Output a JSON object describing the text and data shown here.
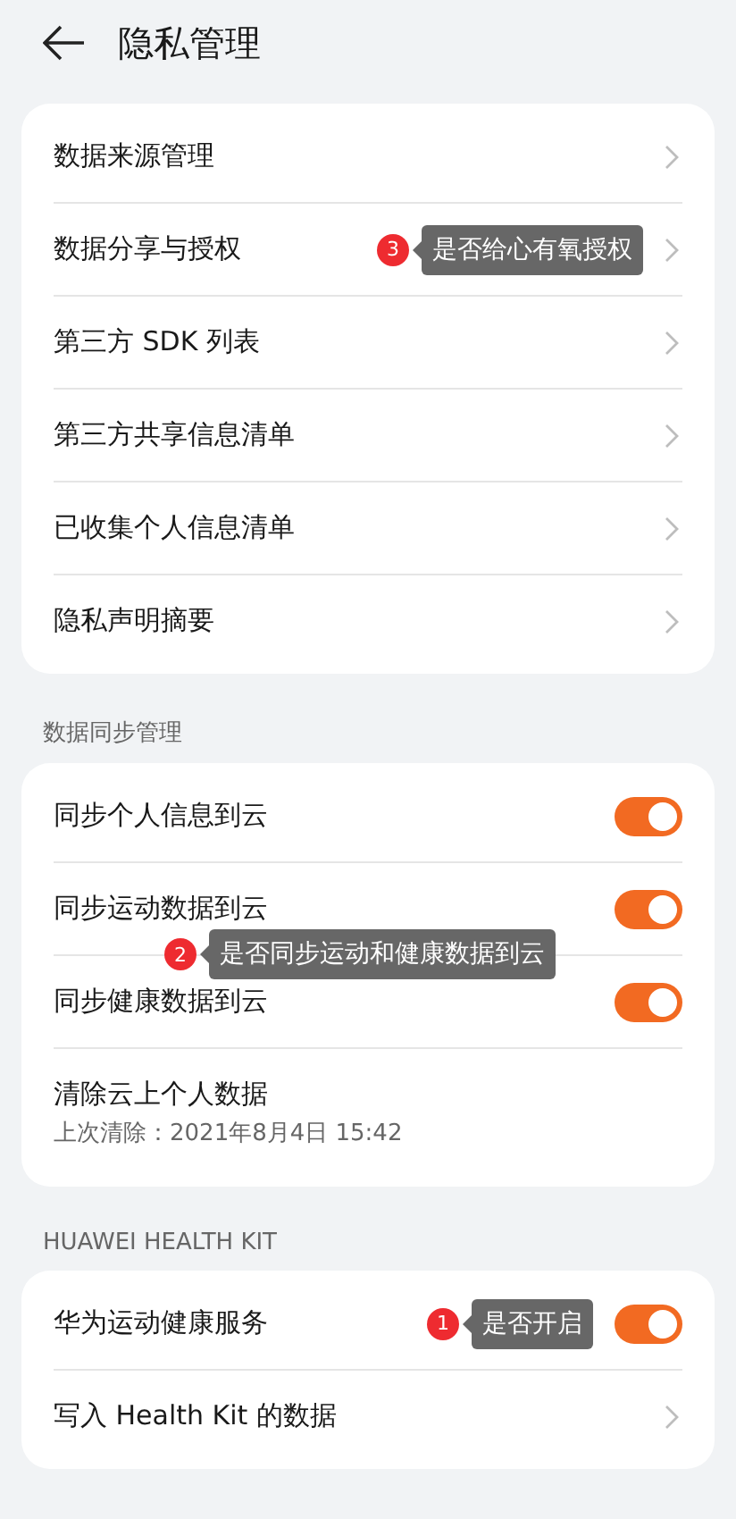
{
  "header": {
    "title": "隐私管理"
  },
  "sections": [
    {
      "rows": [
        {
          "kind": "link",
          "label": "数据来源管理"
        },
        {
          "kind": "link",
          "label": "数据分享与授权",
          "callout": {
            "kind": "inline",
            "number": "3",
            "text": "是否给心有氧授权"
          }
        },
        {
          "kind": "link",
          "label": "第三方 SDK 列表"
        },
        {
          "kind": "link",
          "label": "第三方共享信息清单"
        },
        {
          "kind": "link",
          "label": "已收集个人信息清单"
        },
        {
          "kind": "link",
          "label": "隐私声明摘要"
        }
      ]
    },
    {
      "title": "数据同步管理",
      "rows": [
        {
          "kind": "toggle",
          "label": "同步个人信息到云",
          "on": true
        },
        {
          "kind": "toggle",
          "label": "同步运动数据到云",
          "on": true,
          "callout": {
            "kind": "below",
            "number": "2",
            "text": "是否同步运动和健康数据到云"
          }
        },
        {
          "kind": "toggle",
          "label": "同步健康数据到云",
          "on": true
        },
        {
          "kind": "info",
          "label": "清除云上个人数据",
          "subtitle": "上次清除：2021年8月4日 15:42"
        }
      ]
    },
    {
      "title": "HUAWEI HEALTH KIT",
      "rows": [
        {
          "kind": "toggle",
          "label": "华为运动健康服务",
          "on": true,
          "callout": {
            "kind": "inline",
            "number": "1",
            "text": "是否开启"
          }
        },
        {
          "kind": "link",
          "label": "写入 Health Kit 的数据"
        }
      ]
    }
  ]
}
